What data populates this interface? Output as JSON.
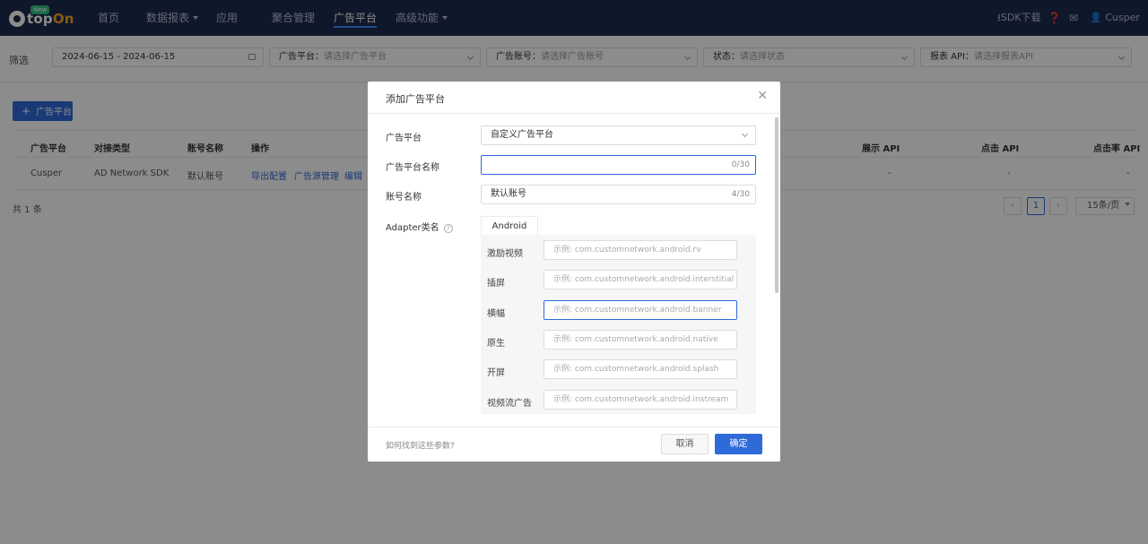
{
  "app": {
    "logo_text_a": "top",
    "logo_text_b": "On",
    "logo_badge": "New"
  },
  "nav": {
    "items": [
      {
        "label": "首页"
      },
      {
        "label": "数据报表"
      },
      {
        "label": "应用"
      },
      {
        "label": "聚合管理"
      },
      {
        "label": "广告平台"
      },
      {
        "label": "高级功能"
      }
    ],
    "active": "广告平台",
    "sdk_download": "SDK下载",
    "user": "Cusper"
  },
  "filters": {
    "label": "筛选",
    "date_range": "2024-06-15 - 2024-06-15",
    "platform_label": "广告平台：",
    "platform_placeholder": "请选择广告平台",
    "account_label": "广告账号：",
    "account_placeholder": "请选择广告账号",
    "status_label": "状态：",
    "status_placeholder": "请选择状态",
    "api_label": "报表 API：",
    "api_placeholder": "请选择报表API"
  },
  "main": {
    "add_button": "广告平台",
    "columns": [
      "广告平台",
      "对接类型",
      "账号名称",
      "操作",
      "展示 API",
      "点击 API",
      "点击率 API"
    ],
    "row": {
      "platform": "Cusper",
      "type": "AD Network SDK",
      "account": "默认账号",
      "actions": [
        "导出配置",
        "广告源管理",
        "编辑"
      ],
      "impression_api": "-",
      "click_api": "-",
      "ctr_api": "-"
    },
    "total": "共 1 条",
    "page": "1",
    "page_size": "15条/页"
  },
  "modal": {
    "title": "添加广告平台",
    "platform_label": "广告平台",
    "platform_value": "自定义广告平台",
    "name_label": "广告平台名称",
    "name_value": "",
    "name_count": "0/30",
    "account_label": "账号名称",
    "account_value": "默认账号",
    "account_count": "4/30",
    "adapter_label": "Adapter类名",
    "tab_android": "Android",
    "adapters": [
      {
        "label": "激励视频",
        "placeholder": "示例: com.customnetwork.android.rv"
      },
      {
        "label": "插屏",
        "placeholder": "示例: com.customnetwork.android.interstitial"
      },
      {
        "label": "横幅",
        "placeholder": "示例: com.customnetwork.android.banner"
      },
      {
        "label": "原生",
        "placeholder": "示例: com.customnetwork.android.native"
      },
      {
        "label": "开屏",
        "placeholder": "示例: com.customnetwork.android.splash"
      },
      {
        "label": "视频流广告",
        "placeholder": "示例: com.customnetwork.android.instream"
      }
    ],
    "footer_hint": "如何找到这些参数?",
    "cancel": "取消",
    "confirm": "确定"
  }
}
